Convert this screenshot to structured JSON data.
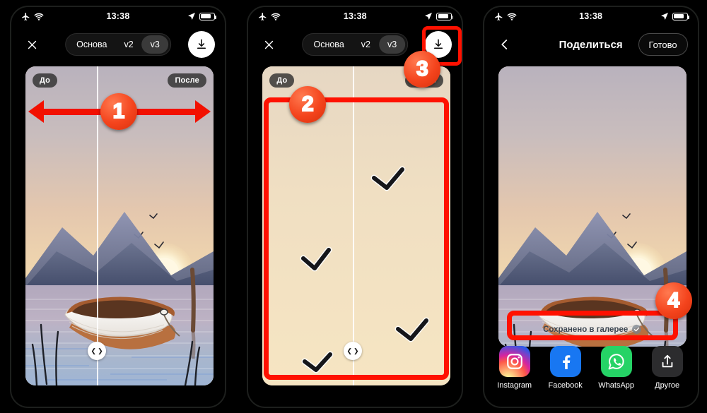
{
  "statusbar": {
    "time": "13:38",
    "icons": [
      "airplane-mode-icon",
      "wifi-icon",
      "location-arrow-icon",
      "battery-icon"
    ]
  },
  "panels": [
    {
      "id": "editor-compare",
      "nav": {
        "close_label": "✕",
        "segments": [
          {
            "label": "Основа",
            "active": false
          },
          {
            "label": "v2",
            "active": false
          },
          {
            "label": "v3",
            "active": true
          }
        ],
        "download_icon": "download-icon"
      },
      "card": {
        "before_label": "До",
        "after_label": "После",
        "handle_icon": "compare-slider-handle"
      },
      "annotations": [
        {
          "type": "double-arrow",
          "number": "1"
        }
      ]
    },
    {
      "id": "editor-zoomed",
      "nav": {
        "close_label": "✕",
        "segments": [
          {
            "label": "Основа",
            "active": false
          },
          {
            "label": "v2",
            "active": false
          },
          {
            "label": "v3",
            "active": true
          }
        ],
        "download_icon": "download-icon"
      },
      "card": {
        "before_label": "До",
        "after_label": "После",
        "handle_icon": "compare-slider-handle"
      },
      "annotations": [
        {
          "type": "rect",
          "number": "2",
          "target": "image-comparison-area"
        },
        {
          "type": "rect",
          "number": "3",
          "target": "download-button"
        }
      ]
    },
    {
      "id": "share-sheet",
      "nav": {
        "back_icon": "chevron-left-icon",
        "title": "Поделиться",
        "done_label": "Готово"
      },
      "saved_banner": {
        "text": "Сохранено в галерее",
        "icon": "check-circle-icon"
      },
      "share_targets": [
        {
          "label": "Instagram",
          "icon": "instagram-icon"
        },
        {
          "label": "Facebook",
          "icon": "facebook-icon"
        },
        {
          "label": "WhatsApp",
          "icon": "whatsapp-icon"
        },
        {
          "label": "Другое",
          "icon": "share-out-icon"
        }
      ],
      "annotations": [
        {
          "type": "rect",
          "number": "4",
          "target": "saved-banner"
        }
      ]
    }
  ],
  "colors": {
    "annotation_red": "#ff1100",
    "badge_orange": "#f4441d",
    "instagram": "#d6249f",
    "facebook": "#1877F2",
    "whatsapp": "#25D366",
    "other": "#2c2c2e"
  }
}
